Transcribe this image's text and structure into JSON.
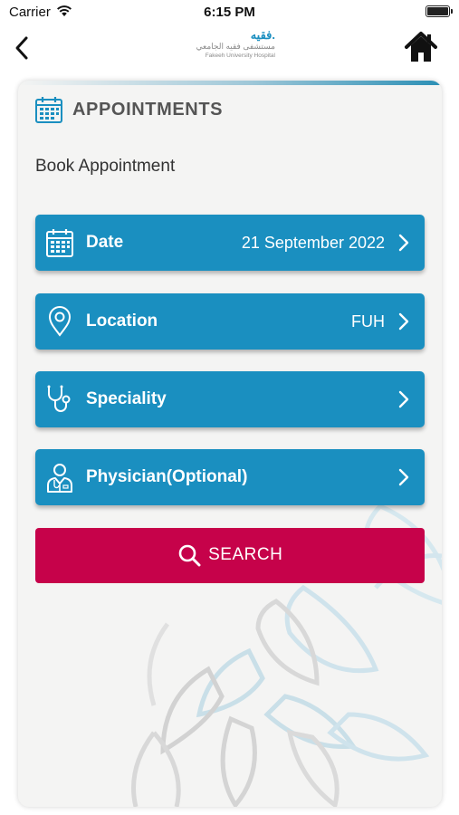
{
  "status_bar": {
    "carrier": "Carrier",
    "time": "6:15 PM"
  },
  "nav": {
    "logo": {
      "brand_ar": "فقيه.",
      "name_ar": "مستشفى فقيه الجامعي",
      "name_en": "Fakeeh University Hospital"
    },
    "back_icon": "chevron-left-icon",
    "home_icon": "home-icon"
  },
  "section": {
    "title": "APPOINTMENTS",
    "icon": "calendar-icon",
    "subtitle": "Book Appointment"
  },
  "rows": [
    {
      "label": "Date",
      "value": "21 September 2022",
      "icon": "calendar-icon"
    },
    {
      "label": "Location",
      "value": "FUH",
      "icon": "location-pin-icon"
    },
    {
      "label": "Speciality",
      "value": "",
      "icon": "stethoscope-icon"
    },
    {
      "label": "Physician(Optional)",
      "value": "",
      "icon": "doctor-icon"
    }
  ],
  "search": {
    "label": "SEARCH",
    "icon": "search-icon"
  },
  "colors": {
    "primary_blue": "#1a8fc0",
    "search_crimson": "#c6024a",
    "card_background": "#f4f4f3",
    "header_text": "#555555"
  }
}
